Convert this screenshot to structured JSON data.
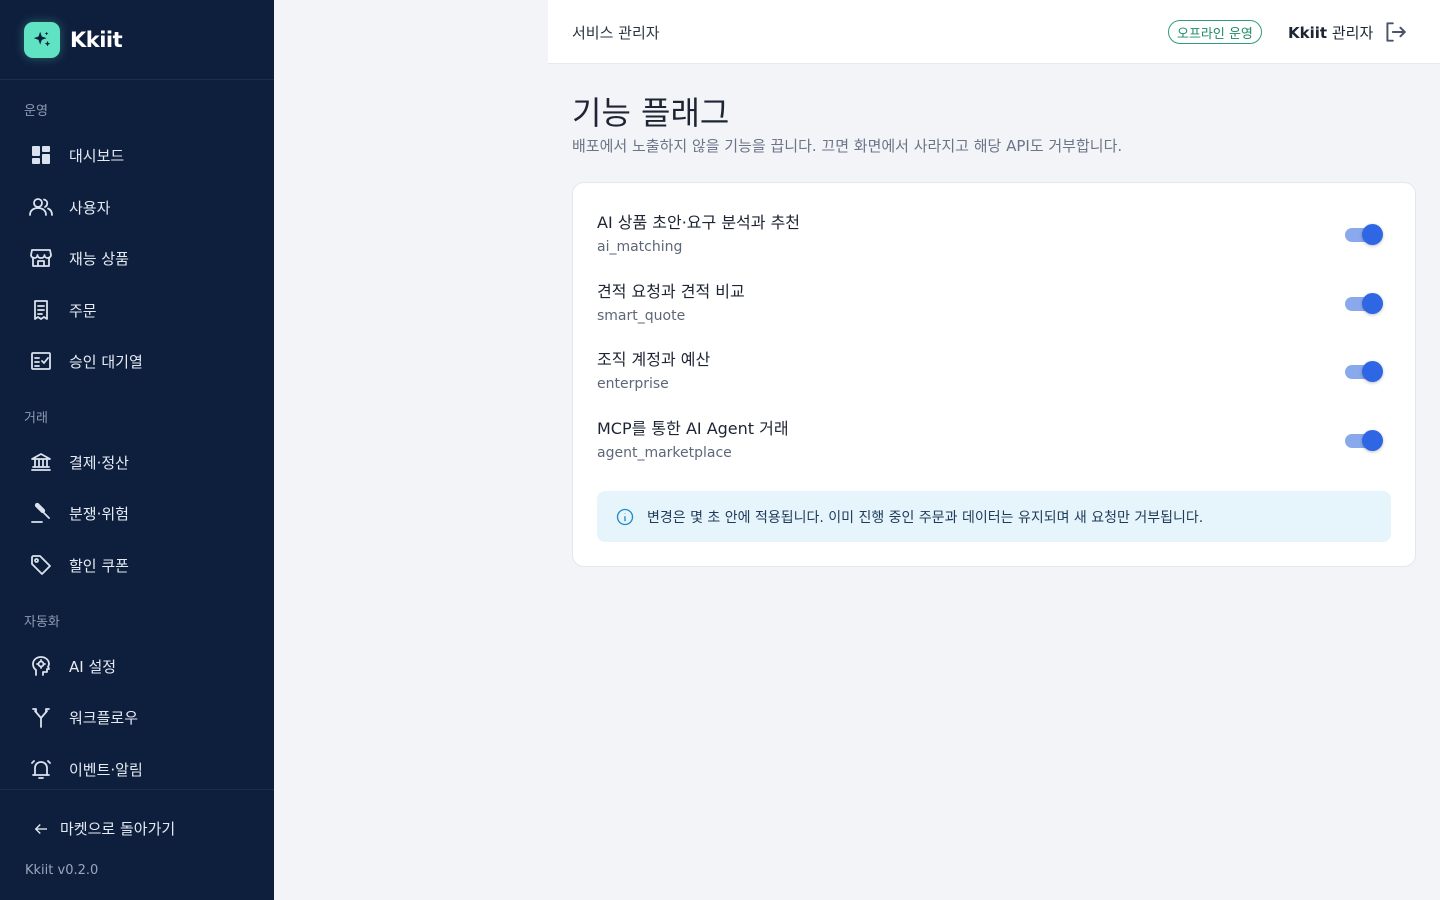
{
  "brand": {
    "name": "Kkiit"
  },
  "sidebar": {
    "sections": [
      {
        "label": "운영"
      },
      {
        "label": "거래"
      },
      {
        "label": "자동화"
      }
    ],
    "items": [
      {
        "label": "대시보드",
        "icon": "dashboard-icon"
      },
      {
        "label": "사용자",
        "icon": "users-icon"
      },
      {
        "label": "재능 상품",
        "icon": "storefront-icon"
      },
      {
        "label": "주문",
        "icon": "receipt-icon"
      },
      {
        "label": "승인 대기열",
        "icon": "approval-queue-icon"
      },
      {
        "label": "결제·정산",
        "icon": "bank-icon"
      },
      {
        "label": "분쟁·위험",
        "icon": "gavel-icon"
      },
      {
        "label": "할인 쿠폰",
        "icon": "tag-icon"
      },
      {
        "label": "AI 설정",
        "icon": "ai-brain-icon"
      },
      {
        "label": "워크플로우",
        "icon": "workflow-icon"
      },
      {
        "label": "이벤트·알림",
        "icon": "alarm-bell-icon"
      }
    ],
    "back_label": "마켓으로 돌아가기",
    "version": "Kkiit v0.2.0"
  },
  "header": {
    "title": "서비스 관리자",
    "status": "오프라인 운영",
    "admin_brand": "Kkiit",
    "admin_role": "관리자"
  },
  "main": {
    "title": "기능 플래그",
    "subtitle": "배포에서 노출하지 않을 기능을 끕니다. 끄면 화면에서 사라지고 해당 API도 거부합니다.",
    "flags": [
      {
        "name": "AI 상품 초안·요구 분석과 추천",
        "key": "ai_matching",
        "enabled": true
      },
      {
        "name": "견적 요청과 견적 비교",
        "key": "smart_quote",
        "enabled": true
      },
      {
        "name": "조직 계정과 예산",
        "key": "enterprise",
        "enabled": true
      },
      {
        "name": "MCP를 통한 AI Agent 거래",
        "key": "agent_marketplace",
        "enabled": true
      }
    ],
    "info": "변경은 몇 초 안에 적용됩니다. 이미 진행 중인 주문과 데이터는 유지되며 새 요청만 거부됩니다."
  },
  "colors": {
    "sidebar_bg": "#0e1f3d",
    "accent": "#2f66e4",
    "brand_mint": "#5fe3c3",
    "status_green": "#1f8a64",
    "info_bg": "#e6f4fb"
  }
}
